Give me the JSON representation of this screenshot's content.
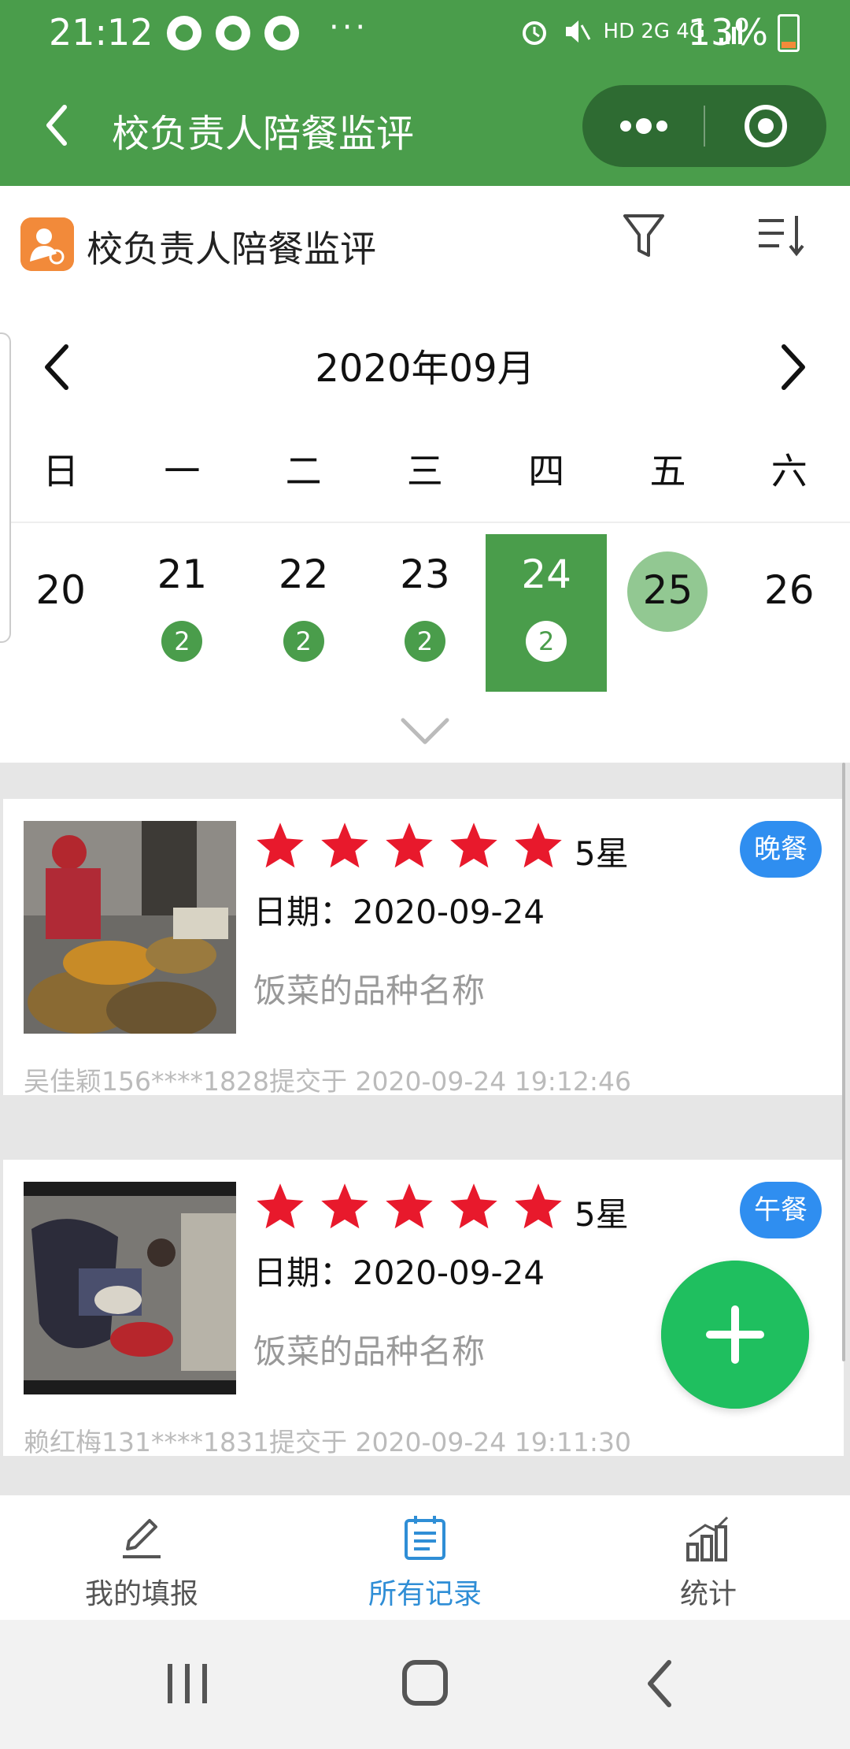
{
  "status_bar": {
    "time": "21:12",
    "overflow": "···",
    "network": "HD 2G 4G",
    "battery": "13%"
  },
  "nav": {
    "title": "校负责人陪餐监评"
  },
  "app": {
    "title": "校负责人陪餐监评"
  },
  "calendar": {
    "month_label": "2020年09月",
    "weekdays": [
      "日",
      "一",
      "二",
      "三",
      "四",
      "五",
      "六"
    ],
    "days": [
      {
        "day": "20",
        "count": ""
      },
      {
        "day": "21",
        "count": "2"
      },
      {
        "day": "22",
        "count": "2"
      },
      {
        "day": "23",
        "count": "2"
      },
      {
        "day": "24",
        "count": "2",
        "selected": true
      },
      {
        "day": "25",
        "count": "",
        "today": true
      },
      {
        "day": "26",
        "count": ""
      }
    ]
  },
  "records": [
    {
      "rating": 5,
      "rating_label": "5星",
      "meal": "晚餐",
      "date": "日期：2020-09-24",
      "dish": "饭菜的品种名称",
      "submitted": "吴佳颖156****1828提交于 2020-09-24 19:12:46"
    },
    {
      "rating": 5,
      "rating_label": "5星",
      "meal": "午餐",
      "date": "日期：2020-09-24",
      "dish": "饭菜的品种名称",
      "submitted": "赖红梅131****1831提交于 2020-09-24 19:11:30"
    }
  ],
  "tabs": [
    {
      "label": "我的填报",
      "icon": "pencil-icon"
    },
    {
      "label": "所有记录",
      "icon": "document-icon",
      "active": true
    },
    {
      "label": "统计",
      "icon": "bar-chart-icon"
    }
  ],
  "colors": {
    "primary_green": "#4a9d4b",
    "today_green": "#92c892",
    "fab_green": "#1fbf5f",
    "meal_badge_blue": "#2f8ef0",
    "star_red": "#e8192c",
    "active_tab_blue": "#2f8ed6",
    "app_icon_orange": "#f28a3a"
  }
}
